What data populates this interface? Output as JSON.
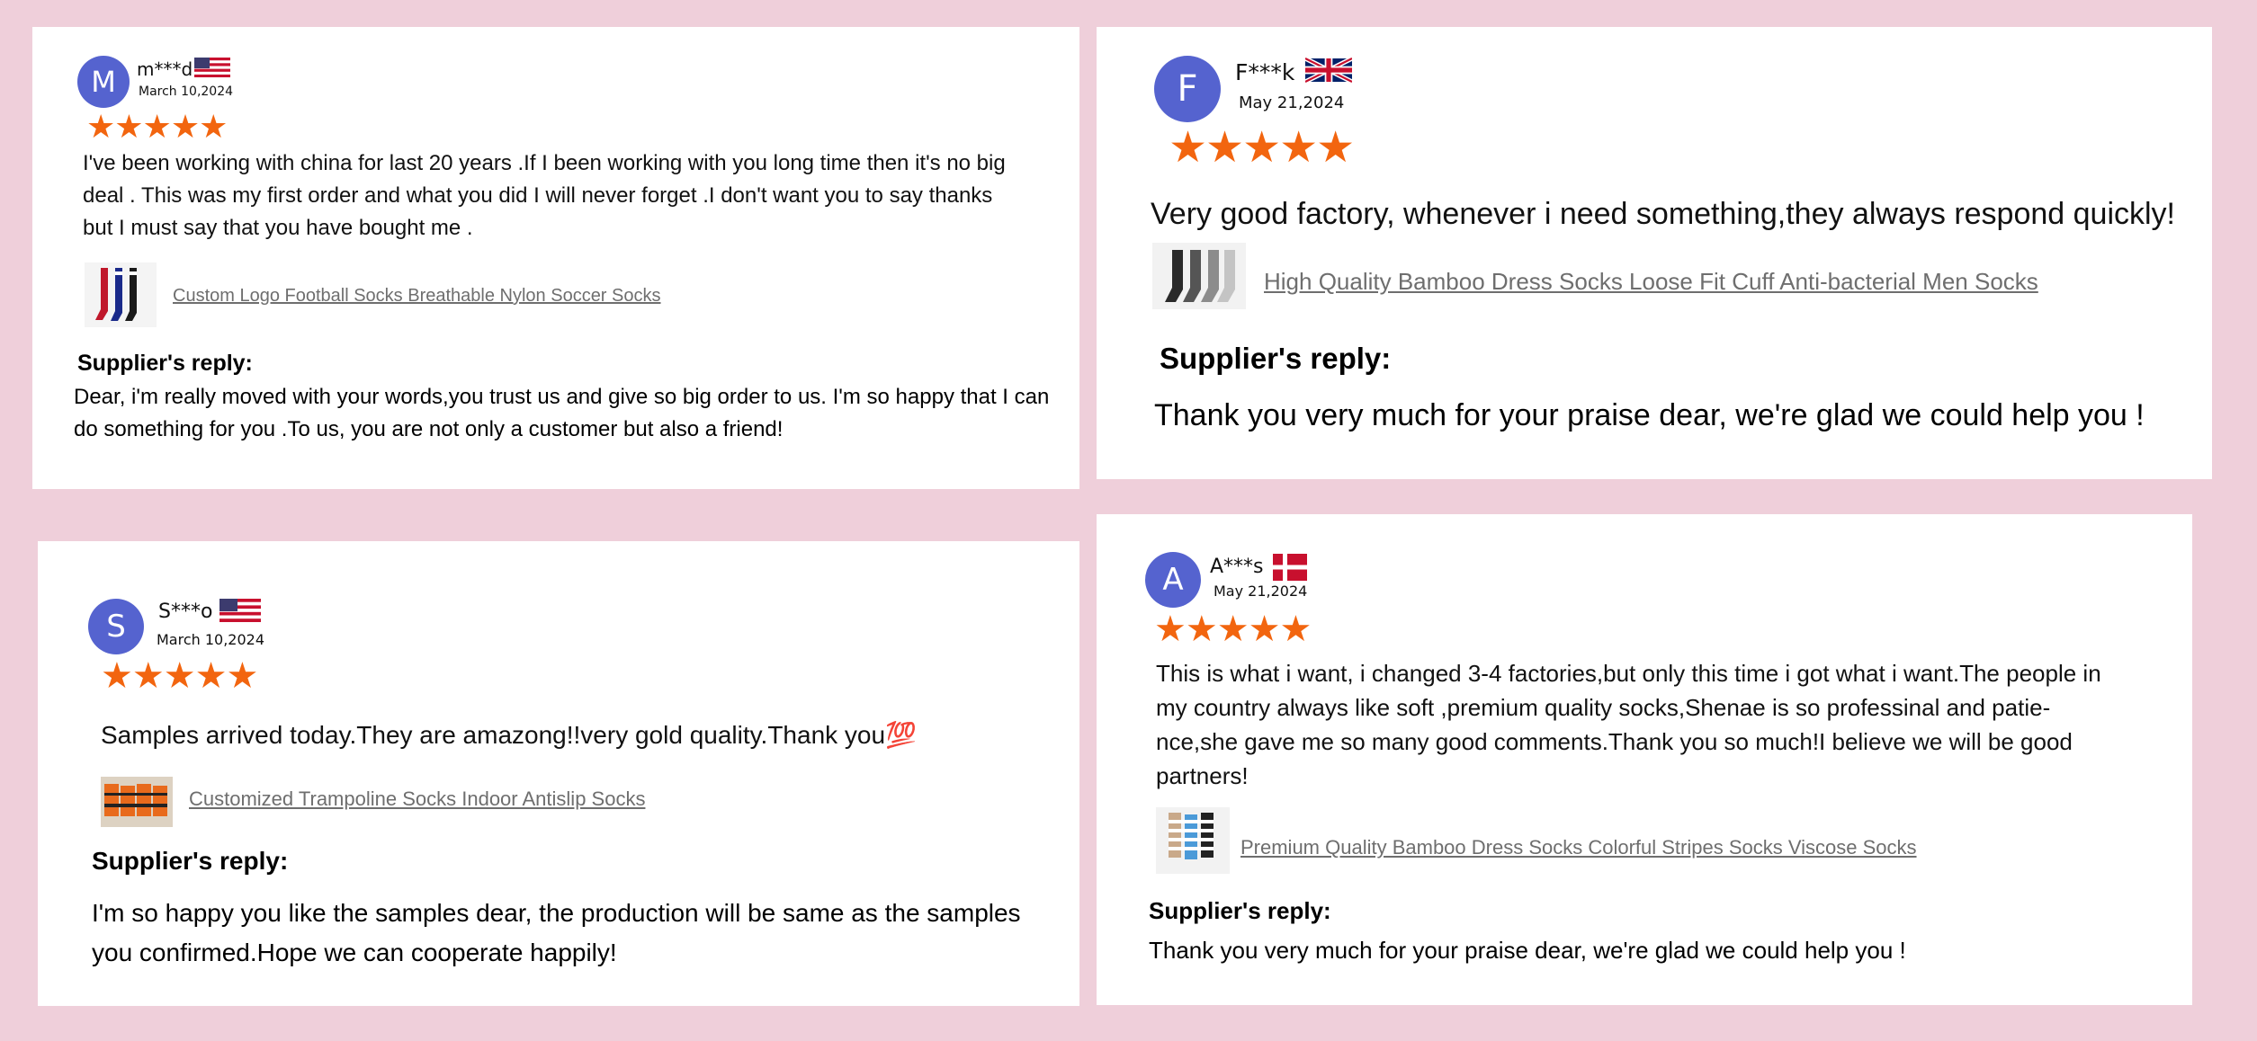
{
  "colors": {
    "background": "#efcfda",
    "card": "#ffffff",
    "avatar": "#5563cf",
    "star": "#f2650f",
    "link": "#6e6e6e"
  },
  "stars": "★★★★★",
  "reviews": [
    {
      "initial": "M",
      "name": "m***d",
      "flag": "us-flag",
      "date": "March 10,2024",
      "rating": 5,
      "text": "I've been working with china for last 20 years .If I been working with you long time then it's no big deal . This was my first order and  what you did I will never forget .I don't want you to say thanks but I must say that you have bought me .",
      "product": "Custom Logo Football Socks Breathable Nylon Soccer Socks",
      "reply_label": "Supplier's reply:",
      "reply": "Dear, i'm really moved with your words,you trust us and give so big order to us. I'm so happy that I can do something for you .To us, you are not only a customer but also a friend!"
    },
    {
      "initial": "F",
      "name": "F***k",
      "flag": "uk-flag",
      "date": "May 21,2024",
      "rating": 5,
      "text": "Very good factory, whenever i need something,they always respond quickly!",
      "product": "High Quality Bamboo Dress Socks Loose Fit  Cuff Anti-bacterial Men Socks",
      "reply_label": "Supplier's reply:",
      "reply": "Thank you very much for your praise dear, we're glad we could help  you !"
    },
    {
      "initial": "S",
      "name": "S***o",
      "flag": "us-flag",
      "date": "March 10,2024",
      "rating": 5,
      "text": "Samples arrived today.They are amazong!!very gold quality.Thank you💯",
      "product": "Customized Trampoline Socks Indoor Antislip Socks",
      "reply_label": "Supplier's reply:",
      "reply": "I'm so happy you like the samples dear, the production will be same as the samples you confirmed.Hope we can cooperate happily!"
    },
    {
      "initial": "A",
      "name": "A***s",
      "flag": "denmark-flag",
      "date": "May 21,2024",
      "rating": 5,
      "text": "This is what i want, i changed 3-4 factories,but only this time i got what i want.The people in my country always like soft ,premium quality socks,Shenae is so professinal and patie-nce,she gave me so many good comments.Thank you so much!I believe we will be good partners!",
      "product": "Premium Quality Bamboo Dress Socks Colorful Stripes Socks Viscose Socks",
      "reply_label": "Supplier's reply:",
      "reply": "Thank you very much for your praise dear, we're glad we could help  you !"
    }
  ]
}
